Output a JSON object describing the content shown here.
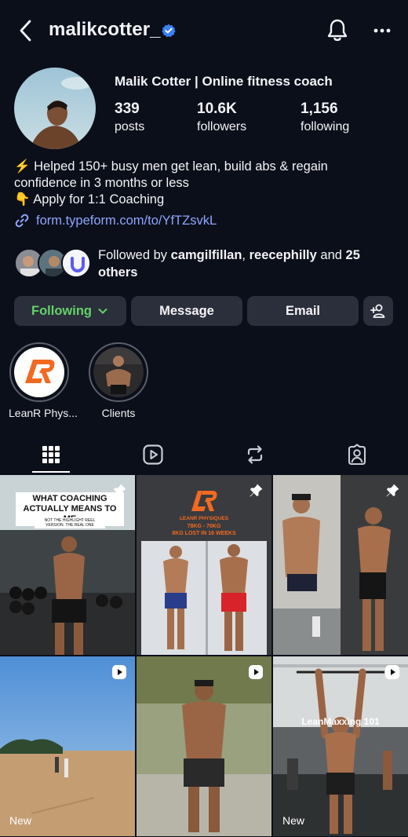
{
  "header": {
    "username": "malikcotter_",
    "back_icon": "chevron-left-icon",
    "verified_icon": "verified-badge-icon",
    "bell_icon": "bell-icon",
    "more_icon": "more-horizontal-icon"
  },
  "profile": {
    "display_name": "Malik Cotter | Online fitness coach",
    "stats": {
      "posts": {
        "value": "339",
        "label": "posts"
      },
      "followers": {
        "value": "10.6K",
        "label": "followers"
      },
      "following": {
        "value": "1,156",
        "label": "following"
      }
    },
    "bio": [
      "⚡ Helped 150+ busy men get lean, build abs & regain",
      "confidence in 3 months or less",
      "👇 Apply for 1:1 Coaching"
    ],
    "link": "form.typeform.com/to/YfTZsvkL",
    "followed_by": {
      "prefix": "Followed by ",
      "user1": "camgilfillan",
      "separator": ", ",
      "user2": "reecephilly",
      "and": " and ",
      "others": "25 others"
    }
  },
  "actions": {
    "following_label": "Following",
    "message_label": "Message",
    "email_label": "Email",
    "add_user_icon": "add-user-icon"
  },
  "highlights": [
    {
      "label": "LeanR Phys..."
    },
    {
      "label": "Clients"
    }
  ],
  "tabs": [
    {
      "name": "posts-grid",
      "icon": "grid-icon"
    },
    {
      "name": "reels",
      "icon": "reels-icon"
    },
    {
      "name": "reposts",
      "icon": "repost-icon"
    },
    {
      "name": "tagged",
      "icon": "tagged-user-icon"
    }
  ],
  "posts": [
    {
      "badge": "pin-icon",
      "overlay_title": "WHAT COACHING ACTUALLY MEANS TO ME",
      "overlay_sub": "NOT THE HIGHLIGHT REEL VERSION. THE REAL ONE"
    },
    {
      "badge": "pin-icon",
      "overlay_title": "LEANR PHYSIQUES",
      "overlay_sub": "78KG - 70KG",
      "overlay_sub2": "8KG LOST IN 16 WEEKS"
    },
    {
      "badge": "pin-icon"
    },
    {
      "badge": "reel-icon",
      "tag": "New"
    },
    {
      "badge": "reel-icon"
    },
    {
      "badge": "reel-icon",
      "overlay_title": "LeanMaxxing 101",
      "tag": "New"
    }
  ],
  "colors": {
    "background": "#0b0f1a",
    "button": "#2a2f3b",
    "following_green": "#63d267",
    "link_blue": "#8ea6ff",
    "verified_blue": "#3b82f6",
    "brand_orange": "#f26a21"
  }
}
